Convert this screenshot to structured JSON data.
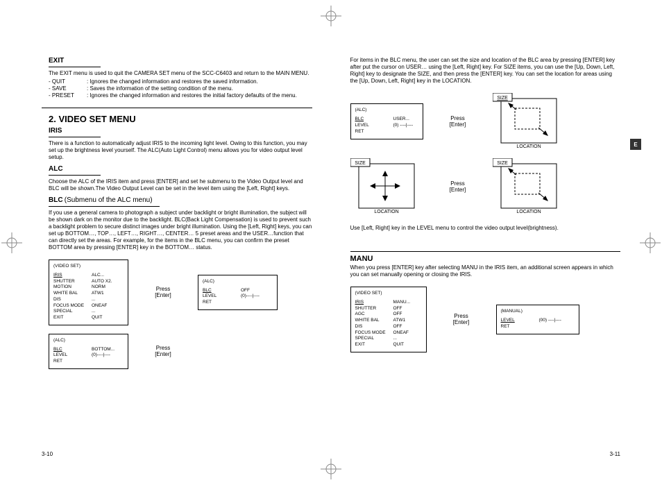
{
  "tab": "E",
  "footer_l": "3-10",
  "footer_r": "3-11",
  "left": {
    "exit": {
      "h": "EXIT",
      "p1": "The EXIT menu is used to quit the CAMERA SET menu of the SCC-C6403 and return to the MAIN MENU.",
      "r1k": "- QUIT",
      "r1v": ": Ignores the changed information and restores the saved information.",
      "r2k": "- SAVE",
      "r2v": ": Saves the information of the setting condition of the menu.",
      "r3k": "- PRESET",
      "r3v": ": Ignores the changed information and restores the initial factory defaults of the menu."
    },
    "h2": "2. VIDEO SET MENU",
    "iris": {
      "h": "IRIS",
      "p": "There is a function to automatically adjust IRIS to the incoming light level. Owing to this function, you may set up the brightness level yourself. The ALC(Auto Light Control) menu allows you for video output level setup."
    },
    "alc": {
      "h": "ALC",
      "p": "Choose the ALC of the IRIS item and press [ENTER] and set he submenu to the Video Output level and BLC will be shown.The Video Output Level can be set in the level item using the [Left, Right] keys."
    },
    "blc": {
      "h1": "BLC",
      "h2": "(Submenu of the ALC menu)",
      "p": "If you use a general camera to photograph a subject under backlight or bright illumination, the subject will be shown dark on the monitor due to the backlight. BLC(Back Light Compensation) is used to prevent such a backlight problem to secure distinct images under bright illumination. Using the [Left, Right] keys, you can set up BOTTOM…, TOP…, LEFT…, RIGHT…, CENTER… 5 preset areas and the USER…function that can directly set the areas. For example, for the items in the BLC menu, you can confirm the preset BOTTOM area by pressing [ENTER] key in the BOTTOM… status."
    },
    "press": "Press\n[Enter]",
    "box1": {
      "title": "(VIDEO SET)",
      "rows": [
        [
          "IRIS",
          "ALC..."
        ],
        [
          "SHUTTER",
          "AUTO X2."
        ],
        [
          "MOTION",
          "NORM"
        ],
        [
          "WHITE BAL",
          "ATW1"
        ],
        [
          "DIS",
          "..."
        ],
        [
          "FOCUS MODE",
          "ONEAF"
        ],
        [
          "SPECIAL",
          "..."
        ],
        [
          "",
          ""
        ],
        [
          "EXIT",
          "QUIT"
        ]
      ],
      "ul0": true
    },
    "box2": {
      "title": "(ALC)",
      "rows": [
        [
          "",
          ""
        ],
        [
          "",
          ""
        ],
        [
          "",
          ""
        ],
        [
          "",
          ""
        ],
        [
          "BLC",
          "BOTTOM..."
        ],
        [
          "LEVEL",
          "(0)----|----"
        ],
        [
          "RET",
          ""
        ]
      ],
      "ul_at": 4
    },
    "box3": {
      "title": "(ALC)",
      "rows": [
        [
          "",
          ""
        ],
        [
          "",
          ""
        ],
        [
          "",
          ""
        ],
        [
          "",
          ""
        ],
        [
          "BLC",
          "OFF"
        ],
        [
          "LEVEL",
          "(0)----|----"
        ],
        [
          "RET",
          ""
        ]
      ],
      "ul_at": 4
    }
  },
  "right": {
    "p1": "For items in the BLC menu, the user can set the size and location of the BLC area by pressing [ENTER] key after put the cursor on USER… using the [Left, Right] key. For SIZE items, you can use the [Up, Down, Left, Right] key to designate the SIZE, and then press the [ENTER] key. You can set the location for areas using the [Up, Down, Left, Right] key in the LOCATION.",
    "press": "Press\n[Enter]",
    "box_a": {
      "title": "(ALC)",
      "rows": [
        [
          "",
          ""
        ],
        [
          "",
          ""
        ],
        [
          "",
          ""
        ],
        [
          "BLC",
          "USER..."
        ],
        [
          "LEVEL",
          "(0)   ----|----"
        ],
        [
          "RET",
          ""
        ]
      ],
      "ul_at": 3
    },
    "svg1": {
      "size": "SIZE",
      "loc": "LOCATION",
      "ul": "size"
    },
    "svg2": {
      "size": "SIZE",
      "loc": "LOCATION"
    },
    "svg3": {
      "size": "SIZE",
      "loc": "LOCATION",
      "ul": "loc"
    },
    "p2": "Use [Left, Right] key in the LEVEL menu to control the video output level(brightness).",
    "manu": {
      "h": "MANU",
      "p": "When you press [ENTER] key after selecting MANU in the IRIS item, an additional screen appears in which you can set manually opening or closing the IRIS."
    },
    "box_b": {
      "title": "(VIDEO SET)",
      "rows": [
        [
          "IRIS",
          "MANU..."
        ],
        [
          "SHUTTER",
          "OFF"
        ],
        [
          "AGC",
          "OFF"
        ],
        [
          "WHITE BAL",
          "ATW1"
        ],
        [
          "DIS",
          "OFF"
        ],
        [
          "FOCUS MODE",
          "ONEAF"
        ],
        [
          "SPECIAL",
          "..."
        ],
        [
          "EXIT",
          "QUIT"
        ]
      ],
      "ul0": true
    },
    "box_c": {
      "title": "(MANUAL)",
      "rows": [
        [
          "",
          ""
        ],
        [
          "",
          ""
        ],
        [
          "",
          ""
        ],
        [
          "LEVEL",
          "(00)   ----|----"
        ],
        [
          "RET",
          ""
        ]
      ],
      "ul_at": 3
    }
  }
}
